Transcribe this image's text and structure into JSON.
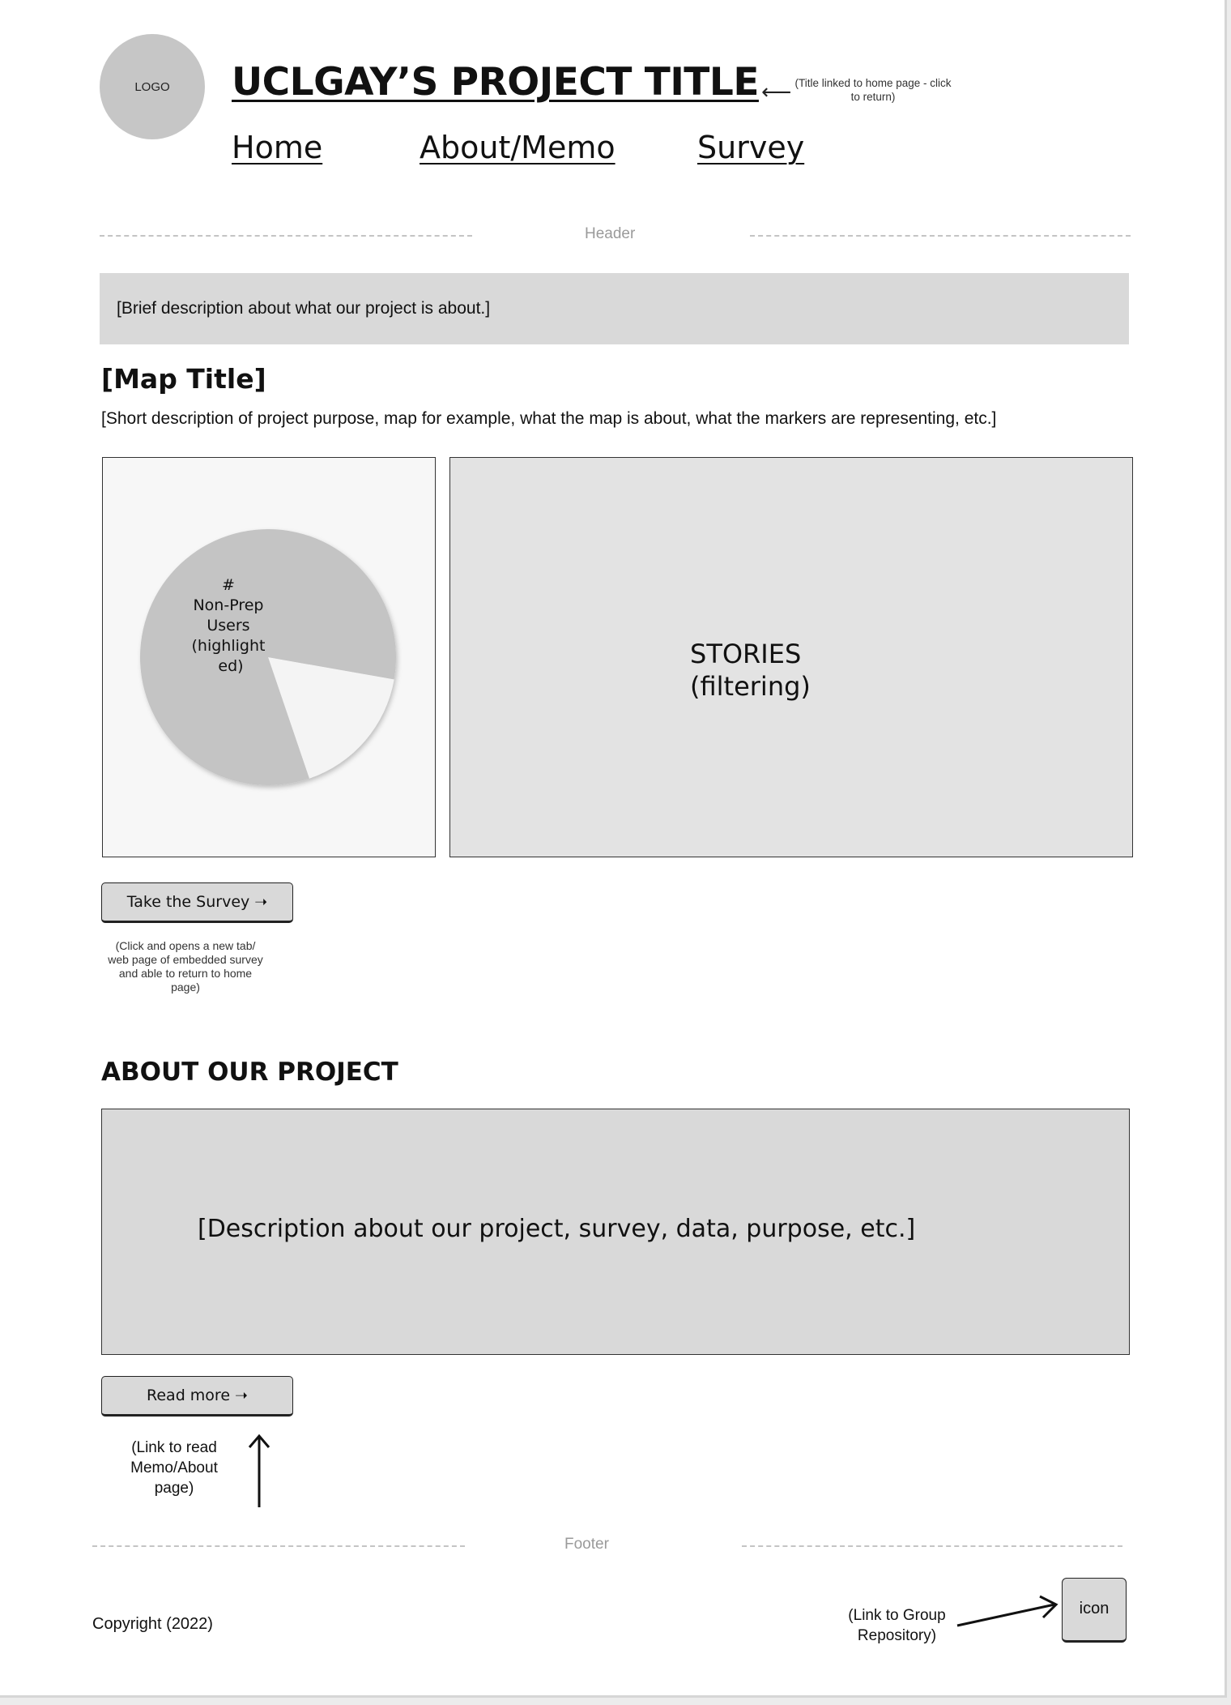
{
  "header": {
    "logo_label": "LOGO",
    "title": "UCLGAY’S PROJECT TITLE",
    "title_arrow": "⟵",
    "title_note": "(Title linked to home page - click to return)",
    "nav": [
      {
        "label": "Home"
      },
      {
        "label": "About/Memo"
      },
      {
        "label": "Survey"
      }
    ],
    "section_label": "Header"
  },
  "intro": {
    "text": "[Brief description about what our project is about.]"
  },
  "map_section": {
    "title": "[Map Title]",
    "description": "[Short description of project purpose, map for example, what the map is about, what the markers are representing, etc.]",
    "pie": {
      "label_lines": [
        "#",
        "Non-Prep",
        "Users",
        "(highlight",
        "ed)"
      ],
      "highlighted_share": 0.83,
      "colors": {
        "highlighted": "#c4c4c4",
        "rest": "#f4f4f4"
      }
    },
    "stories_text": "STORIES\n(filtering)"
  },
  "survey": {
    "button_label": "Take the Survey ➝",
    "note": "(Click and opens a new tab/ web page of embedded survey and able to return to home page)"
  },
  "about": {
    "heading": "ABOUT OUR PROJECT",
    "description": "[Description about our project, survey, data, purpose, etc.]",
    "read_more_label": "Read more ➝",
    "read_more_note": "(Link to read Memo/About page)"
  },
  "footer": {
    "section_label": "Footer",
    "copyright": "Copyright (2022)",
    "repo_note": "(Link to Group Repository)",
    "icon_label": "icon"
  }
}
